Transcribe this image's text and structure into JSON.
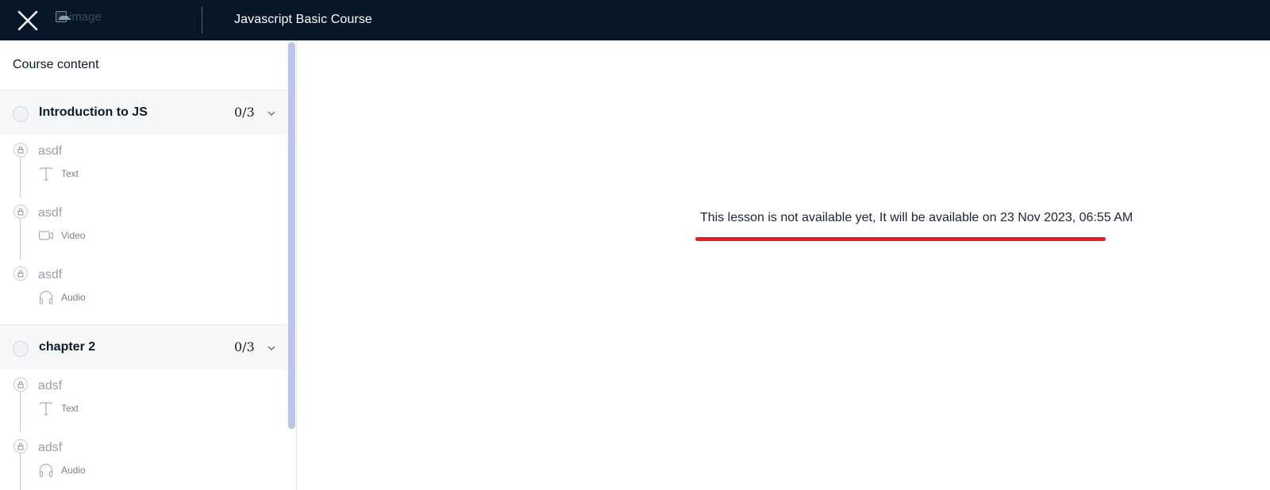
{
  "header": {
    "logo_alt": "image",
    "course_title": "Javascript Basic Course"
  },
  "sidebar": {
    "title": "Course content",
    "chapters": [
      {
        "name": "Introduction to JS",
        "progress": "0/3",
        "lessons": [
          {
            "name": "asdf",
            "type": "Text",
            "icon": "text-icon"
          },
          {
            "name": "asdf",
            "type": "Video",
            "icon": "video-icon"
          },
          {
            "name": "asdf",
            "type": "Audio",
            "icon": "headphones-icon"
          }
        ]
      },
      {
        "name": "chapter 2",
        "progress": "0/3",
        "lessons": [
          {
            "name": "adsf",
            "type": "Text",
            "icon": "text-icon"
          },
          {
            "name": "adsf",
            "type": "Audio",
            "icon": "headphones-icon"
          }
        ]
      }
    ]
  },
  "main": {
    "notice": "This lesson is not available yet, It will be available on 23 Nov 2023, 06:55 AM"
  },
  "colors": {
    "topbar": "#061629",
    "accent_underline": "#e41e26",
    "scroll_thumb": "#bcc3ef"
  }
}
